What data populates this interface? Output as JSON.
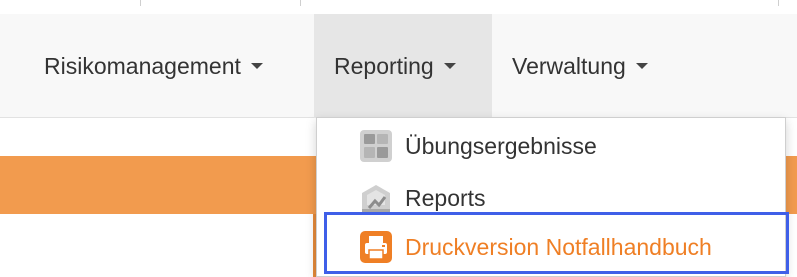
{
  "navbar": {
    "items": [
      {
        "label": "Risikomanagement",
        "active": false
      },
      {
        "label": "Reporting",
        "active": true
      },
      {
        "label": "Verwaltung",
        "active": false
      }
    ]
  },
  "reporting_menu": {
    "items": [
      {
        "label": "Übungsergebnisse",
        "icon": "exercise-results-icon"
      },
      {
        "label": "Reports",
        "icon": "reports-icon"
      },
      {
        "label": "Druckversion Notfallhandbuch",
        "icon": "printer-icon",
        "highlighted": true
      }
    ]
  },
  "colors": {
    "accent_orange": "#f29b4e",
    "active_item_text": "#ef7f25",
    "highlight_border": "#3f5fe8",
    "navbar_bg": "#f8f8f8",
    "active_nav_bg": "#e6e6e6"
  }
}
